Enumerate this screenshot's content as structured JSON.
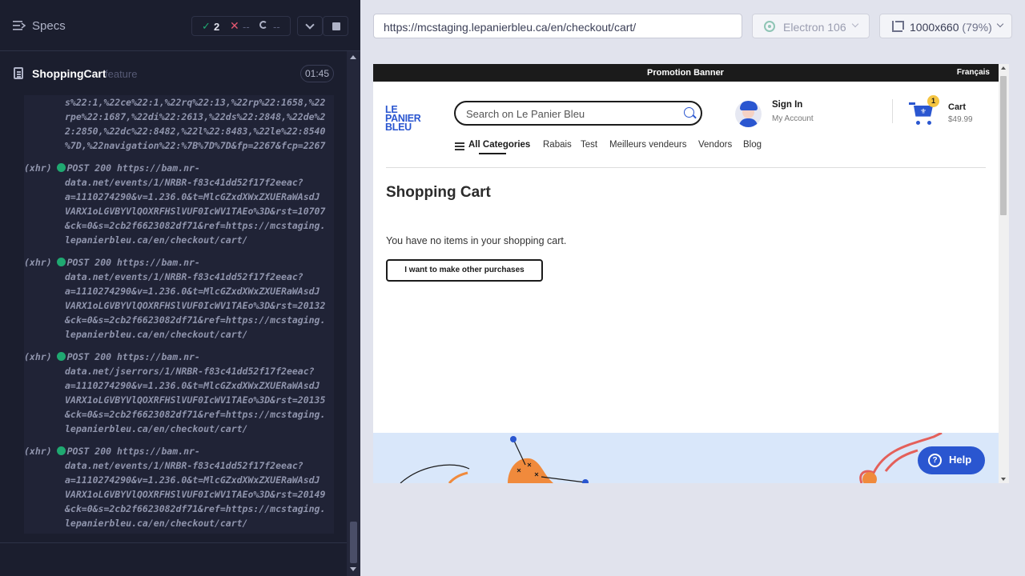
{
  "reporter": {
    "specs_label": "Specs",
    "stats": {
      "passed": "2",
      "failed": "--",
      "pending": "--"
    },
    "spec": {
      "name": "ShoppingCart",
      "extension": "feature",
      "duration": "01:45"
    },
    "log_lines": [
      "s%22:1,%22ce%22:1,%22rq%22:13,%22rp%22:1658,%22",
      "rpe%22:1687,%22di%22:2613,%22ds%22:2848,%22de%2",
      "2:2850,%22dc%22:8482,%22l%22:8483,%22le%22:8540",
      "%7D,%22navigation%22:%7B%7D%7D&fp=2267&fcp=2267"
    ],
    "xhr_entries": [
      {
        "tag": "(xhr)",
        "method": "POST",
        "status": "200",
        "lines": [
          "https://bam.nr-",
          "data.net/events/1/NRBR-f83c41dd52f17f2eeac?",
          "a=1110274290&v=1.236.0&t=MlcGZxdXWxZXUERaWAsdJ",
          "VARX1oLGVBYVlQOXRFHSlVUF0IcWV1TAEo%3D&rst=10707",
          "&ck=0&s=2cb2f6623082df71&ref=https://mcstaging.",
          "lepanierbleu.ca/en/checkout/cart/"
        ]
      },
      {
        "tag": "(xhr)",
        "method": "POST",
        "status": "200",
        "lines": [
          "https://bam.nr-",
          "data.net/events/1/NRBR-f83c41dd52f17f2eeac?",
          "a=1110274290&v=1.236.0&t=MlcGZxdXWxZXUERaWAsdJ",
          "VARX1oLGVBYVlQOXRFHSlVUF0IcWV1TAEo%3D&rst=20132",
          "&ck=0&s=2cb2f6623082df71&ref=https://mcstaging.",
          "lepanierbleu.ca/en/checkout/cart/"
        ]
      },
      {
        "tag": "(xhr)",
        "method": "POST",
        "status": "200",
        "lines": [
          "https://bam.nr-",
          "data.net/jserrors/1/NRBR-f83c41dd52f17f2eeac?",
          "a=1110274290&v=1.236.0&t=MlcGZxdXWxZXUERaWAsdJ",
          "VARX1oLGVBYVlQOXRFHSlVUF0IcWV1TAEo%3D&rst=20135",
          "&ck=0&s=2cb2f6623082df71&ref=https://mcstaging.",
          "lepanierbleu.ca/en/checkout/cart/"
        ]
      },
      {
        "tag": "(xhr)",
        "method": "POST",
        "status": "200",
        "lines": [
          "https://bam.nr-",
          "data.net/events/1/NRBR-f83c41dd52f17f2eeac?",
          "a=1110274290&v=1.236.0&t=MlcGZxdXWxZXUERaWAsdJ",
          "VARX1oLGVBYVlQOXRFHSlVUF0IcWV1TAEo%3D&rst=20149",
          "&ck=0&s=2cb2f6623082df71&ref=https://mcstaging.",
          "lepanierbleu.ca/en/checkout/cart/"
        ]
      }
    ]
  },
  "runner": {
    "url": "https://mcstaging.lepanierbleu.ca/en/checkout/cart/",
    "browser": "Electron 106",
    "viewport": "1000x660",
    "scale": "(79%)"
  },
  "site": {
    "promo_banner": "Promotion Banner",
    "language_link": "Français",
    "logo_lines": [
      "LE",
      "PANIER",
      "BLEU"
    ],
    "search_placeholder": "Search on Le Panier Bleu",
    "account": {
      "sign_in": "Sign In",
      "my_account": "My Account"
    },
    "cart": {
      "label": "Cart",
      "total": "$49.99",
      "badge": "1"
    },
    "nav": {
      "all_categories": "All Categories",
      "items": [
        "Rabais",
        "Test",
        "Meilleurs vendeurs",
        "Vendors",
        "Blog"
      ]
    },
    "page_title": "Shopping Cart",
    "empty_message": "You have no items in your shopping cart.",
    "cta_button": "I want to make other purchases",
    "help_button": "Help"
  },
  "colors": {
    "reporter_bg": "#1b1e2e",
    "pass_green": "#1fa971",
    "fail_red": "#e45770",
    "brand_blue": "#2a56d0",
    "footer_band": "#d9e7fa"
  }
}
